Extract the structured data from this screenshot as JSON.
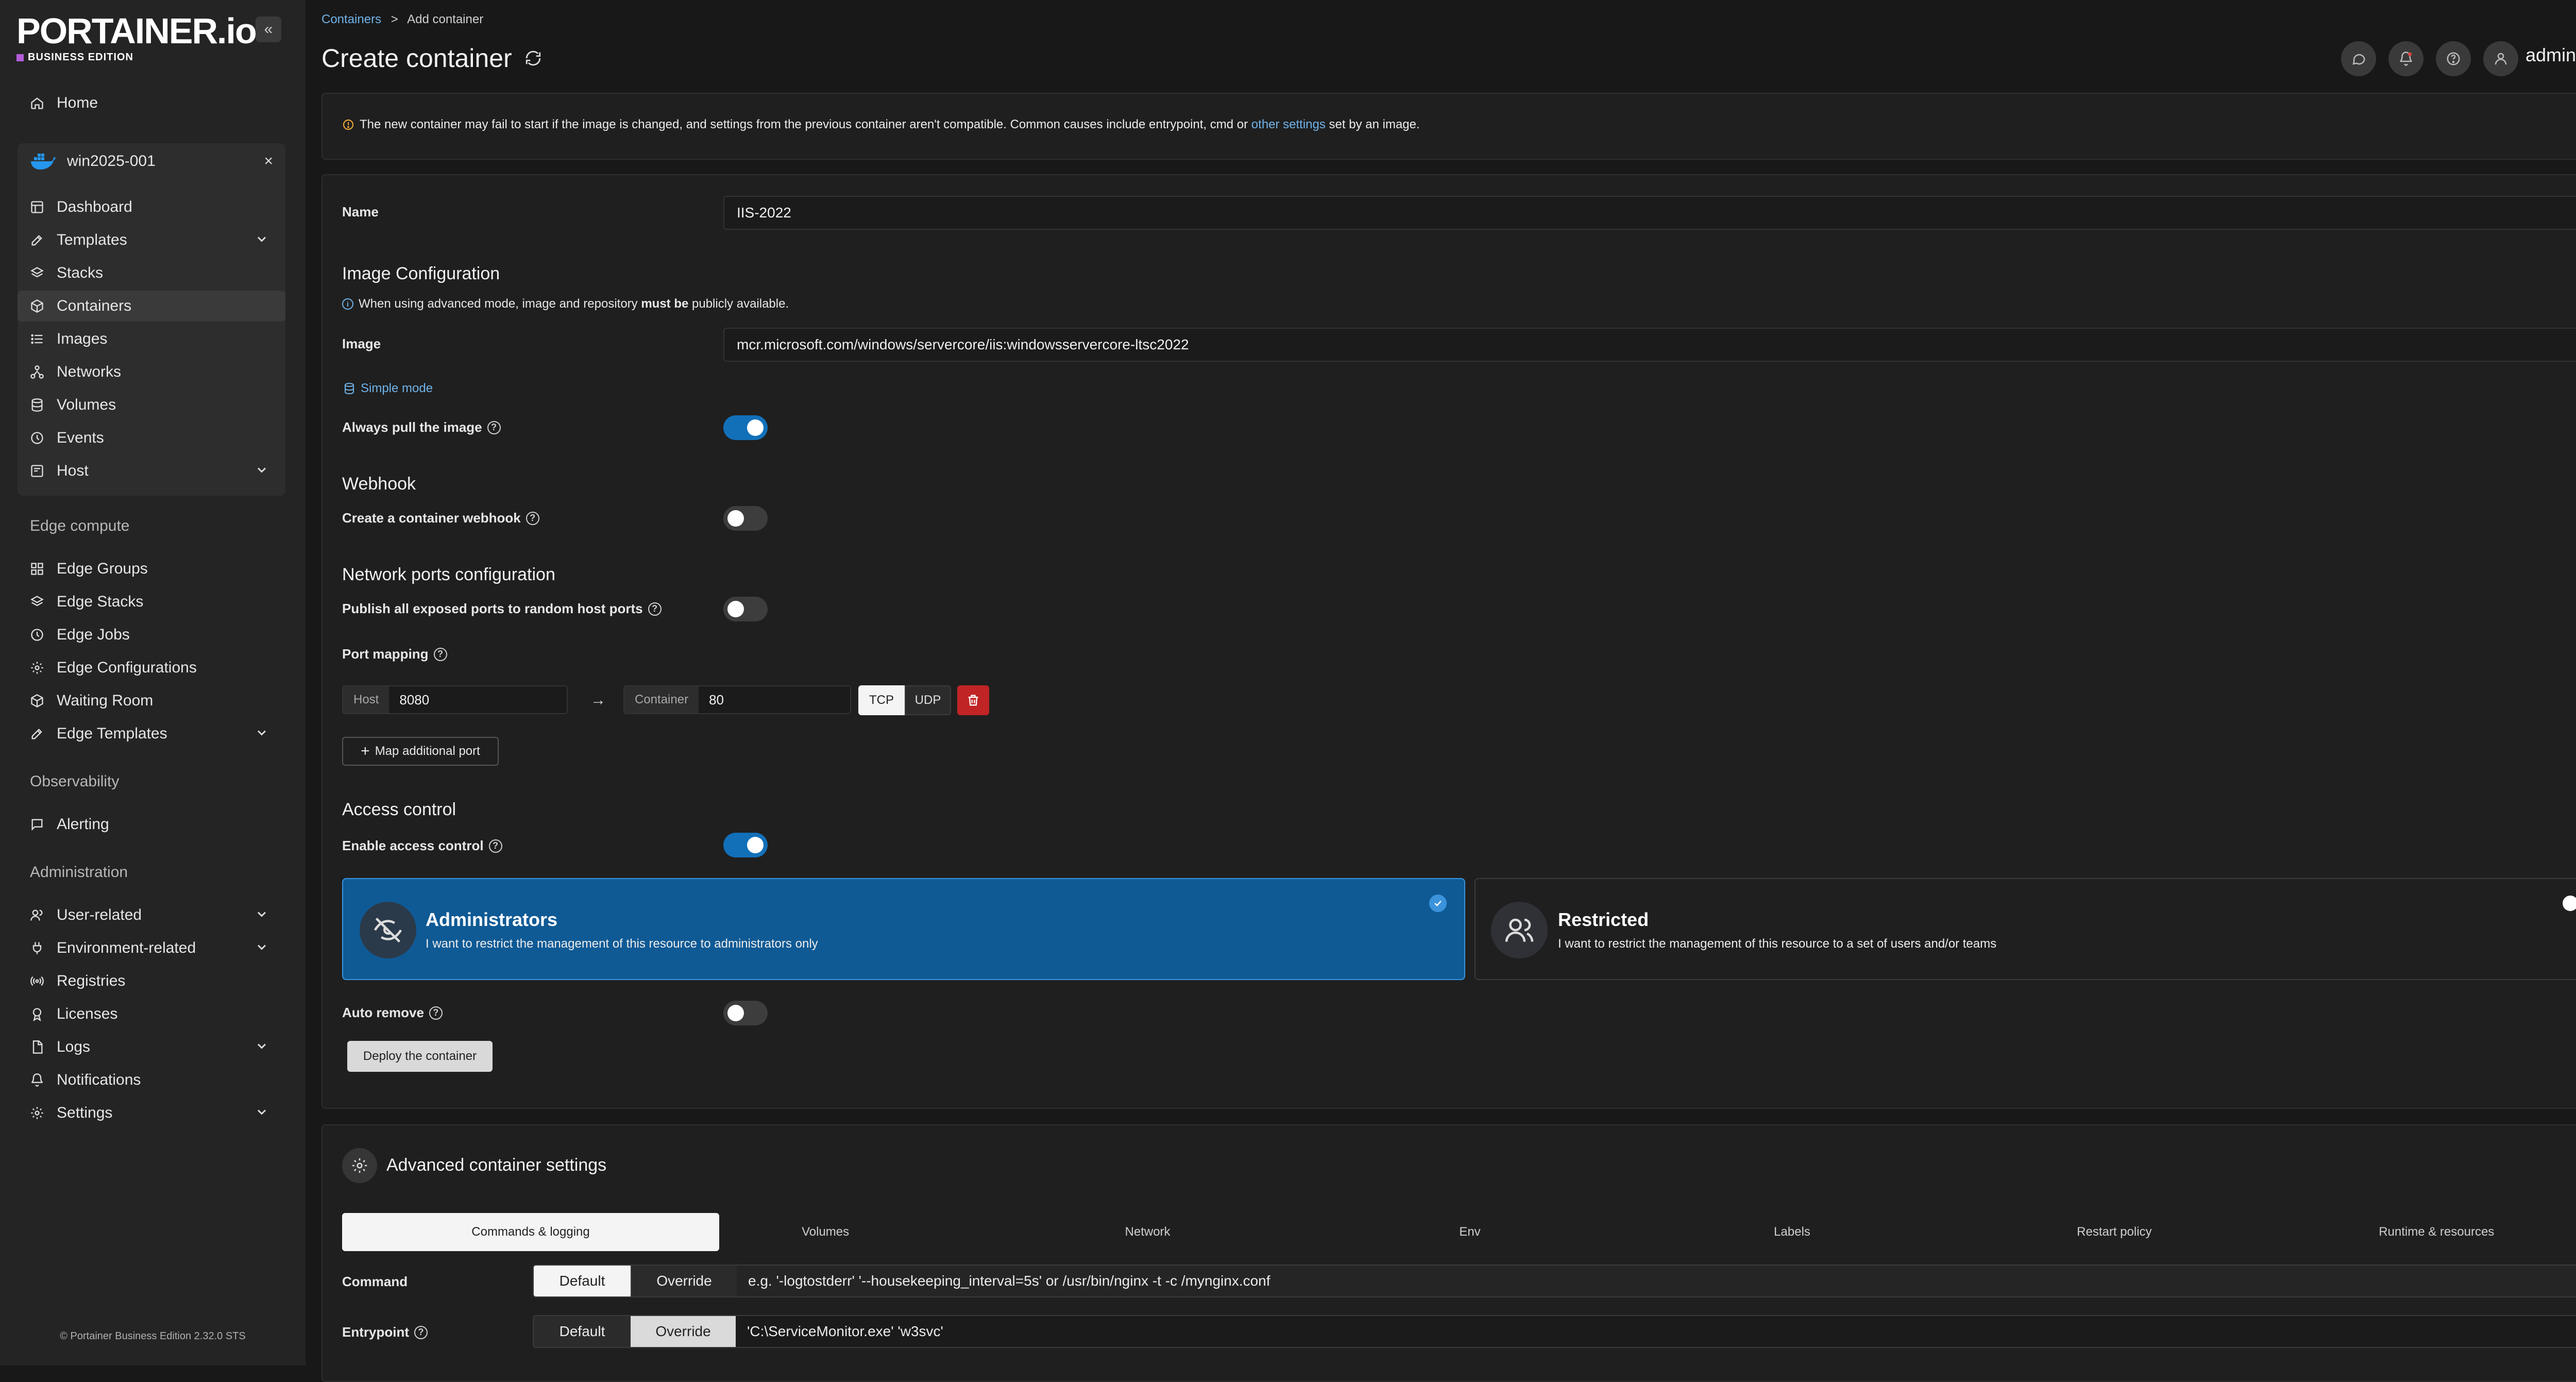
{
  "brand": {
    "logo_text": "PORTAINER.io",
    "edition": "BUSINESS EDITION",
    "edition_color": "#b35cd8"
  },
  "sidebar": {
    "collapse_glyph": "«",
    "home": "Home",
    "environment": {
      "name": "win2025-001",
      "close_glyph": "×",
      "items": [
        {
          "label": "Dashboard",
          "icon": "dashboard-icon"
        },
        {
          "label": "Templates",
          "icon": "edit-icon",
          "expandable": true
        },
        {
          "label": "Stacks",
          "icon": "layers-icon"
        },
        {
          "label": "Containers",
          "icon": "box-icon",
          "active": true
        },
        {
          "label": "Images",
          "icon": "list-icon"
        },
        {
          "label": "Networks",
          "icon": "network-icon"
        },
        {
          "label": "Volumes",
          "icon": "database-icon"
        },
        {
          "label": "Events",
          "icon": "clock-icon"
        },
        {
          "label": "Host",
          "icon": "server-icon",
          "expandable": true
        }
      ]
    },
    "edge_compute": {
      "heading": "Edge compute",
      "items": [
        {
          "label": "Edge Groups",
          "icon": "grid-icon"
        },
        {
          "label": "Edge Stacks",
          "icon": "layers-icon"
        },
        {
          "label": "Edge Jobs",
          "icon": "clock-icon"
        },
        {
          "label": "Edge Configurations",
          "icon": "settings-icon"
        },
        {
          "label": "Waiting Room",
          "icon": "box-icon"
        },
        {
          "label": "Edge Templates",
          "icon": "edit-icon",
          "expandable": true
        }
      ]
    },
    "observability": {
      "heading": "Observability",
      "items": [
        {
          "label": "Alerting",
          "icon": "message-icon"
        }
      ]
    },
    "administration": {
      "heading": "Administration",
      "items": [
        {
          "label": "User-related",
          "icon": "users-icon",
          "expandable": true
        },
        {
          "label": "Environment-related",
          "icon": "plug-icon",
          "expandable": true
        },
        {
          "label": "Registries",
          "icon": "radio-icon"
        },
        {
          "label": "Licenses",
          "icon": "award-icon"
        },
        {
          "label": "Logs",
          "icon": "file-icon",
          "expandable": true
        },
        {
          "label": "Notifications",
          "icon": "bell-icon"
        },
        {
          "label": "Settings",
          "icon": "gear-icon",
          "expandable": true
        }
      ]
    },
    "footer": "© Portainer Business Edition 2.32.0 STS"
  },
  "header": {
    "breadcrumb_link": "Containers",
    "breadcrumb_sep": ">",
    "breadcrumb_current": "Add container",
    "title": "Create container",
    "user": "admin"
  },
  "warning": {
    "text_before": "The new container may fail to start if the image is changed, and settings from the previous container aren't compatible. Common causes include entrypoint, cmd or ",
    "link": "other settings",
    "text_after": " set by an image."
  },
  "form": {
    "name_label": "Name",
    "name_value": "IIS-2022",
    "image_config_heading": "Image Configuration",
    "image_note_before": "When using advanced mode, image and repository ",
    "image_note_bold": "must be",
    "image_note_after": " publicly available.",
    "image_label": "Image",
    "image_value": "mcr.microsoft.com/windows/servercore/iis:windowsservercore-ltsc2022",
    "simple_mode": "Simple mode",
    "always_pull_label": "Always pull the image",
    "always_pull_on": true,
    "webhook_heading": "Webhook",
    "webhook_label": "Create a container webhook",
    "webhook_on": false,
    "network_heading": "Network ports configuration",
    "publish_all_label": "Publish all exposed ports to random host ports",
    "publish_all_on": false,
    "port_mapping_label": "Port mapping",
    "port": {
      "host_addon": "Host",
      "host_value": "8080",
      "arrow": "→",
      "container_addon": "Container",
      "container_value": "80",
      "tcp": "TCP",
      "udp": "UDP"
    },
    "map_additional": "Map additional port",
    "access_heading": "Access control",
    "enable_access_label": "Enable access control",
    "enable_access_on": true,
    "admin_title": "Administrators",
    "admin_desc": "I want to restrict the management of this resource to administrators only",
    "restricted_title": "Restricted",
    "restricted_desc": "I want to restrict the management of this resource to a set of users and/or teams",
    "auto_remove_label": "Auto remove",
    "auto_remove_on": false,
    "deploy_button": "Deploy the container"
  },
  "advanced": {
    "heading": "Advanced container settings",
    "tabs": [
      "Commands & logging",
      "Volumes",
      "Network",
      "Env",
      "Labels",
      "Restart policy",
      "Runtime & resources"
    ],
    "command_label": "Command",
    "command_default": "Default",
    "command_override": "Override",
    "command_placeholder": "e.g. '-logtostderr' '--housekeeping_interval=5s' or /usr/bin/nginx -t -c /mynginx.conf",
    "entrypoint_label": "Entrypoint",
    "entrypoint_default": "Default",
    "entrypoint_override": "Override",
    "entrypoint_value": "'C:\\ServiceMonitor.exe' 'w3svc'"
  },
  "colors": {
    "accent_blue": "#1270b9",
    "link_blue": "#6fb3ea",
    "danger_red": "#c02424"
  }
}
